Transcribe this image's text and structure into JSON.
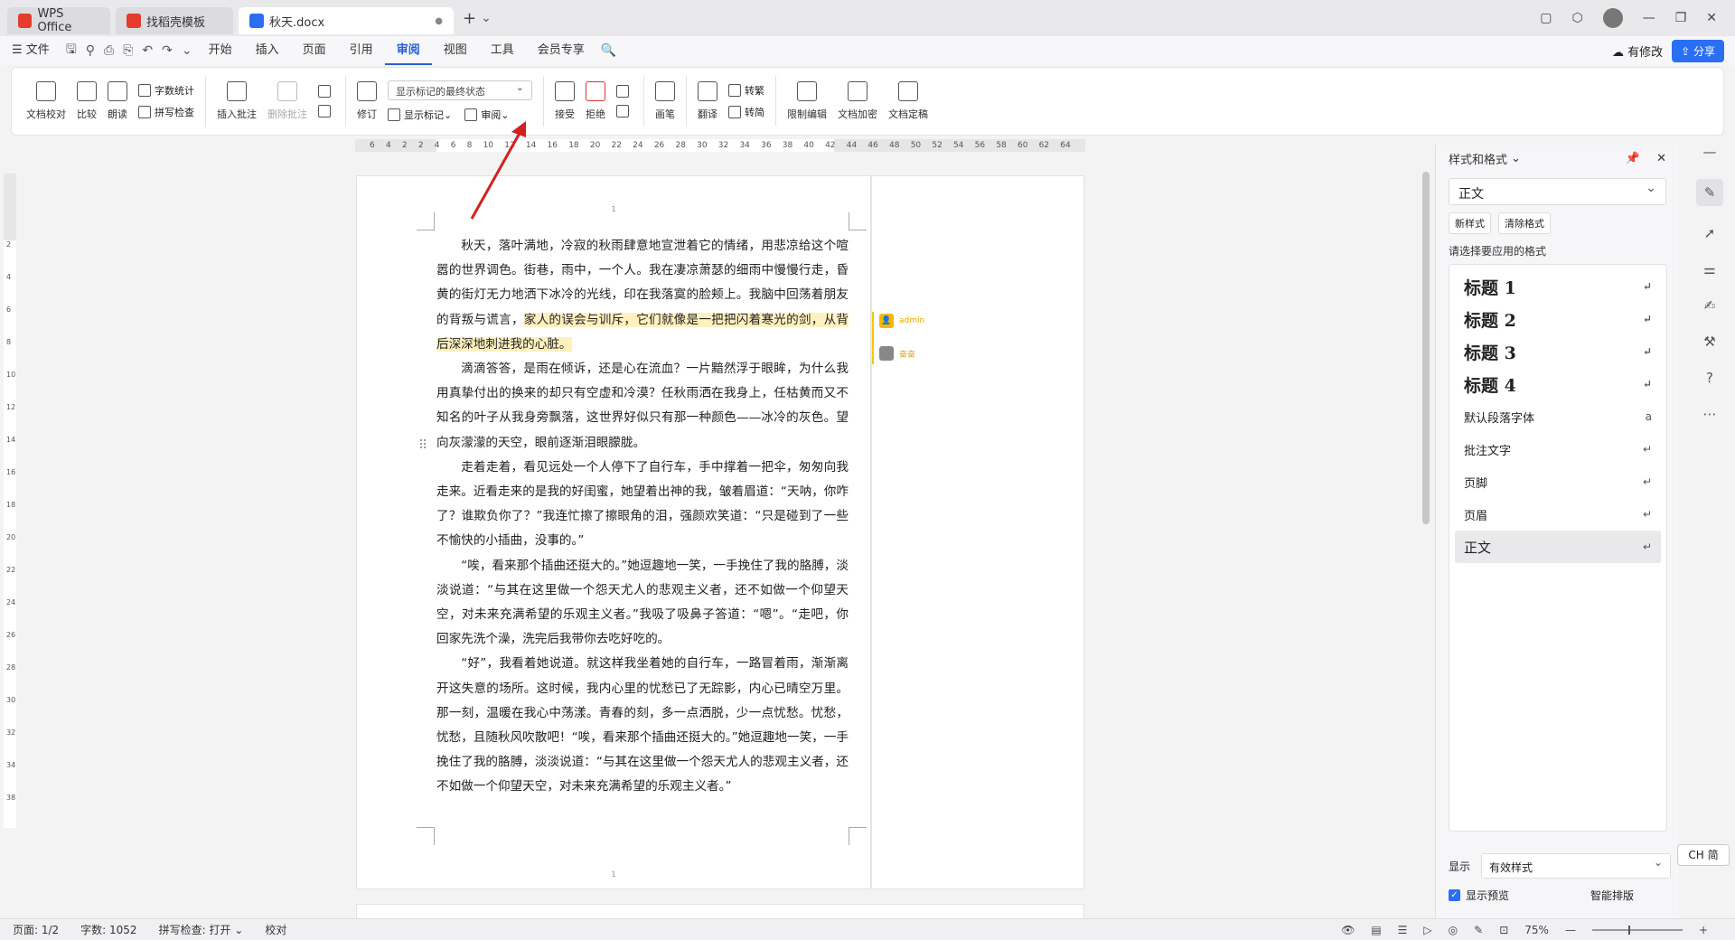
{
  "titlebar": {
    "tabs": [
      {
        "label": "WPS Office",
        "color": "#e43b2c"
      },
      {
        "label": "找稻壳模板",
        "color": "#e43b2c"
      },
      {
        "label": "秋天.docx",
        "color": "#2a6ff3"
      }
    ],
    "new_tab": "+"
  },
  "menubar": {
    "file": "文件",
    "tabs": [
      "开始",
      "插入",
      "页面",
      "引用",
      "审阅",
      "视图",
      "工具",
      "会员专享"
    ],
    "active_tab": "审阅",
    "has_changes": "有修改",
    "share": "分享"
  },
  "ribbon": {
    "proofread": "文档校对",
    "compare": "比较",
    "read_aloud": "朗读",
    "word_count": "字数统计",
    "spell_check": "拼写检查",
    "insert_comment": "插入批注",
    "delete_comment": "删除批注",
    "track_changes": "修订",
    "markup_select": "显示标记的最终状态",
    "show_markup": "显示标记",
    "review": "审阅",
    "accept": "接受",
    "reject": "拒绝",
    "pen": "画笔",
    "translate": "翻译",
    "to_traditional": "转繁",
    "to_simplified": "转简",
    "restrict_edit": "限制编辑",
    "doc_encrypt": "文档加密",
    "doc_finalize": "文档定稿"
  },
  "hruler": {
    "labels": [
      "6",
      "4",
      "2",
      "2",
      "4",
      "6",
      "8",
      "10",
      "12",
      "14",
      "16",
      "18",
      "20",
      "22",
      "24",
      "26",
      "28",
      "30",
      "32",
      "34",
      "36",
      "38",
      "40",
      "42",
      "44",
      "46",
      "48",
      "50",
      "52",
      "54",
      "56",
      "58",
      "60",
      "62",
      "64"
    ]
  },
  "vruler": {
    "labels": [
      "2",
      "4",
      "6",
      "8",
      "10",
      "12",
      "14",
      "16",
      "18",
      "20",
      "22",
      "24",
      "26",
      "28",
      "30",
      "32",
      "34",
      "38"
    ]
  },
  "document": {
    "page_number": "1",
    "paragraphs": [
      {
        "before": "秋天，落叶满地，冷寂的秋雨肆意地宣泄着它的情绪，用悲凉给这个喧嚣的世界调色。街巷，雨中，一个人。我在凄凉萧瑟的细雨中慢慢行走，昏黄的街灯无力地洒下冰冷的光线，印在我落寞的脸颊上。我脑中回荡着朋友的背叛与谎言，",
        "highlight": "家人的误会与训斥，它们就像是一把把闪着寒光的剑，从背后深深地刺进我的心脏。",
        "after": ""
      },
      {
        "before": "滴滴答答，是雨在倾诉，还是心在流血？一片黯然浮于眼眸，为什么我用真挚付出的换来的却只有空虚和冷漠？任秋雨洒在我身上，任枯黄而又不知名的叶子从我身旁飘落，这世界好似只有那一种颜色——冰冷的灰色。望向灰濛濛的天空，眼前逐渐泪眼朦胧。",
        "highlight": "",
        "after": ""
      },
      {
        "before": "走着走着，看见远处一个人停下了自行车，手中撑着一把伞，匆匆向我走来。近看走来的是我的好闺蜜，她望着出神的我，皱着眉道：“天呐，你咋了？谁欺负你了？”我连忙擦了擦眼角的泪，强颜欢笑道：“只是碰到了一些不愉快的小插曲，没事的。”",
        "highlight": "",
        "after": ""
      },
      {
        "before": "“唉，看来那个插曲还挺大的。”她逗趣地一笑，一手挽住了我的胳膊，淡淡说道：“与其在这里做一个怨天尤人的悲观主义者，还不如做一个仰望天空，对未来充满希望的乐观主义者。”我吸了吸鼻子答道：“嗯”。“走吧，你回家先洗个澡，洗完后我带你去吃好吃的。",
        "highlight": "",
        "after": ""
      },
      {
        "before": "“好”，我看着她说道。就这样我坐着她的自行车，一路冒着雨，渐渐离开这失意的场所。这时候，我内心里的忧愁已了无踪影，内心已晴空万里。那一刻，温暖在我心中荡漾。青春的刻，多一点洒脱，少一点忧愁。忧愁，忧愁，且随秋风吹散吧！“唉，看来那个插曲还挺大的。”她逗趣地一笑，一手挽住了我的胳膊，淡淡说道：“与其在这里做一个怨天尤人的悲观主义者，还不如做一个仰望天空，对未来充满希望的乐观主义者。”",
        "highlight": "",
        "after": ""
      }
    ],
    "comments": [
      {
        "author": "admin"
      },
      {
        "author": "奋奋"
      }
    ]
  },
  "panel": {
    "title": "样式和格式",
    "current_style": "正文",
    "new_style": "新样式",
    "clear_format": "清除格式",
    "prompt": "请选择要应用的格式",
    "styles": [
      {
        "name": "标题  1",
        "heading": true
      },
      {
        "name": "标题  2",
        "heading": true
      },
      {
        "name": "标题  3",
        "heading": true
      },
      {
        "name": "标题  4",
        "heading": true
      },
      {
        "name": "默认段落字体",
        "heading": false
      },
      {
        "name": "批注文字",
        "heading": false
      },
      {
        "name": "页脚",
        "heading": false
      },
      {
        "name": "页眉",
        "heading": false
      },
      {
        "name": "正文",
        "heading": false,
        "selected": true
      }
    ],
    "show_label": "显示",
    "show_value": "有效样式",
    "show_preview": "显示预览",
    "smart_layout": "智能排版"
  },
  "ime": "CH 简",
  "statusbar": {
    "page": "页面: 1/2",
    "words": "字数: 1052",
    "spell": "拼写检查: 打开",
    "proof": "校对",
    "zoom": "75%"
  }
}
